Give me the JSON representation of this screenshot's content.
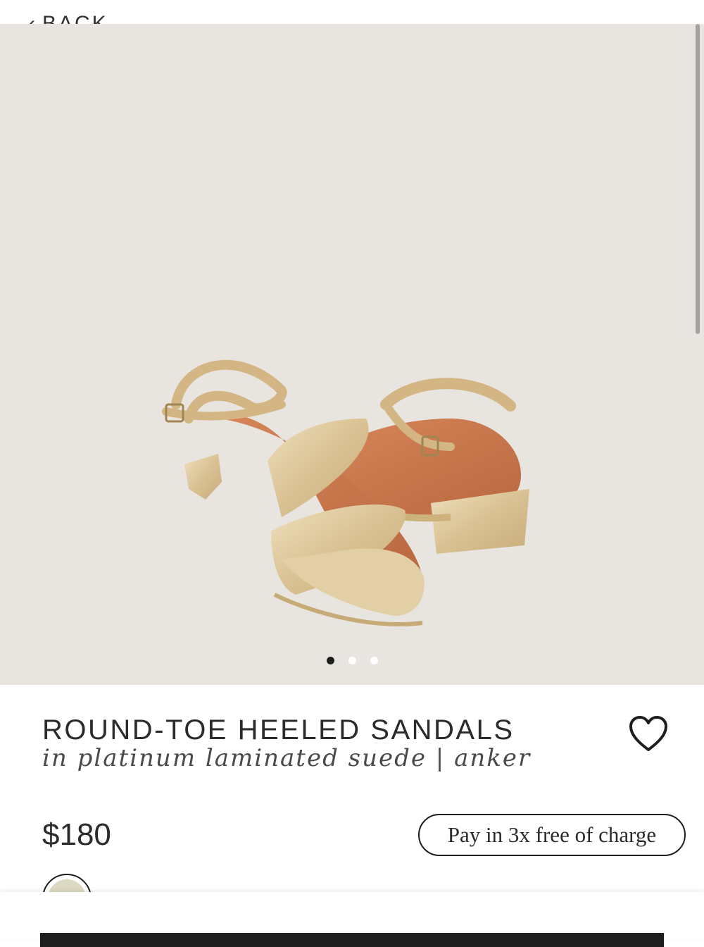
{
  "header": {
    "back_label": "BACK"
  },
  "gallery": {
    "image_description_icon": "sandals-photo",
    "page_count": 3,
    "active_page": 1
  },
  "product": {
    "title": "ROUND-TOE HEELED SANDALS",
    "subtitle": "in platinum laminated suede | anker",
    "price": "$180",
    "installment_label": "Pay in 3x free of charge",
    "swatch_color": "#dcd9c2",
    "wishlist_icon": "heart-outline-icon"
  },
  "colors": {
    "gallery_bg": "#e8e5e0",
    "text": "#2b2b2b",
    "accent": "#1e1e1e"
  }
}
